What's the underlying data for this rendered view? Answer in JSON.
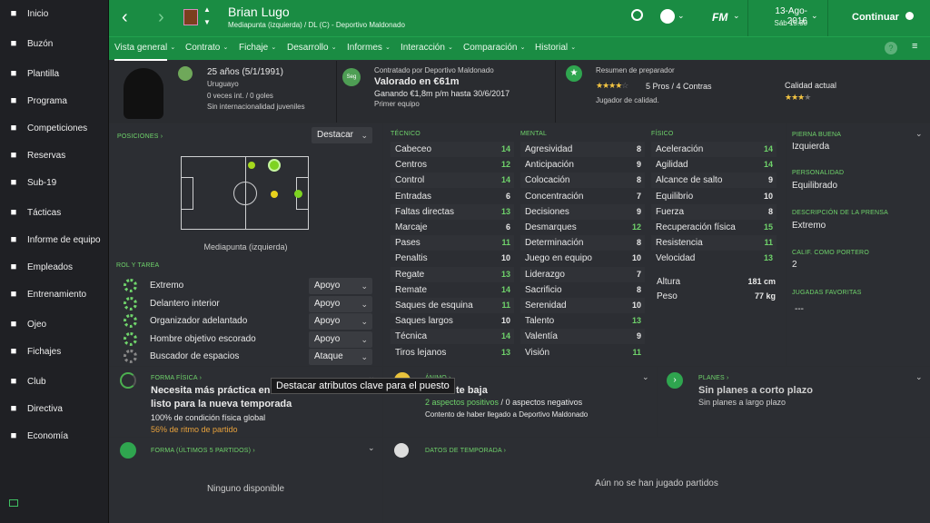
{
  "sidebar": {
    "items": [
      {
        "label": "Inicio",
        "icon": "home-icon"
      },
      {
        "label": "Buzón",
        "icon": "inbox-icon"
      },
      {
        "label": "Plantilla",
        "icon": "squad-icon"
      },
      {
        "label": "Programa",
        "icon": "schedule-icon"
      },
      {
        "label": "Competiciones",
        "icon": "trophy-icon"
      },
      {
        "label": "Reservas",
        "icon": "reserves-icon"
      },
      {
        "label": "Sub-19",
        "icon": "youth-icon"
      },
      {
        "label": "Tácticas",
        "icon": "tactics-icon"
      },
      {
        "label": "Informe de equipo",
        "icon": "report-icon"
      },
      {
        "label": "Empleados",
        "icon": "staff-icon"
      },
      {
        "label": "Entrenamiento",
        "icon": "training-icon"
      },
      {
        "label": "Ojeo",
        "icon": "scout-icon"
      },
      {
        "label": "Fichajes",
        "icon": "transfer-icon"
      },
      {
        "label": "Club",
        "icon": "club-icon"
      },
      {
        "label": "Directiva",
        "icon": "board-icon"
      },
      {
        "label": "Economía",
        "icon": "finance-icon"
      }
    ]
  },
  "top": {
    "player_name": "Brian Lugo",
    "player_sub": "Mediapunta (izquierda) / DL (C) - Deportivo Maldonado",
    "logo": "FM",
    "date": "13-Ago-2016",
    "date_sub": "Sáb 15:30",
    "continue": "Continuar"
  },
  "tabs": [
    "Vista general",
    "Contrato",
    "Fichaje",
    "Desarrollo",
    "Informes",
    "Interacción",
    "Comparación",
    "Historial"
  ],
  "header": {
    "age": "25 años (5/1/1991)",
    "nationality": "Uruguayo",
    "caps": "0 veces int. / 0 goles",
    "caps_sub": "Sin internacionalidad juveniles",
    "contract_title": "Contratado por Deportivo Maldonado",
    "value": "Valorado en €61m",
    "wage": "Ganando €1,8m p/m hasta 30/6/2017",
    "squad": "Primer equipo",
    "contract_badge": "Seg",
    "coach_title": "Resumen de preparador",
    "pros": "5 Pros / 4 Contras",
    "quality_note": "Jugador de calidad.",
    "current_ability": "Calidad actual"
  },
  "positions": {
    "label": "POSICIONES",
    "highlight": "Destacar",
    "pos_name": "Mediapunta (izquierda)"
  },
  "roles": {
    "label": "ROL Y TAREA",
    "items": [
      {
        "name": "Extremo",
        "duty": "Apoyo"
      },
      {
        "name": "Delantero interior",
        "duty": "Apoyo"
      },
      {
        "name": "Organizador adelantado",
        "duty": "Apoyo"
      },
      {
        "name": "Hombre objetivo escorado",
        "duty": "Apoyo"
      },
      {
        "name": "Buscador de espacios",
        "duty": "Ataque"
      }
    ]
  },
  "tecnico": {
    "label": "TÉCNICO",
    "items": [
      {
        "n": "Cabeceo",
        "v": "14"
      },
      {
        "n": "Centros",
        "v": "12"
      },
      {
        "n": "Control",
        "v": "14"
      },
      {
        "n": "Entradas",
        "v": "6"
      },
      {
        "n": "Faltas directas",
        "v": "13"
      },
      {
        "n": "Marcaje",
        "v": "6"
      },
      {
        "n": "Pases",
        "v": "11"
      },
      {
        "n": "Penaltis",
        "v": "10"
      },
      {
        "n": "Regate",
        "v": "13"
      },
      {
        "n": "Remate",
        "v": "14"
      },
      {
        "n": "Saques de esquina",
        "v": "11"
      },
      {
        "n": "Saques largos",
        "v": "10"
      },
      {
        "n": "Técnica",
        "v": "14"
      },
      {
        "n": "Tiros lejanos",
        "v": "13"
      }
    ]
  },
  "mental": {
    "label": "MENTAL",
    "items": [
      {
        "n": "Agresividad",
        "v": "8"
      },
      {
        "n": "Anticipación",
        "v": "9"
      },
      {
        "n": "Colocación",
        "v": "8"
      },
      {
        "n": "Concentración",
        "v": "7"
      },
      {
        "n": "Decisiones",
        "v": "9"
      },
      {
        "n": "Desmarques",
        "v": "12"
      },
      {
        "n": "Determinación",
        "v": "8"
      },
      {
        "n": "Juego en equipo",
        "v": "10"
      },
      {
        "n": "Liderazgo",
        "v": "7"
      },
      {
        "n": "Sacrificio",
        "v": "8"
      },
      {
        "n": "Serenidad",
        "v": "10"
      },
      {
        "n": "Talento",
        "v": "13"
      },
      {
        "n": "Valentía",
        "v": "9"
      },
      {
        "n": "Visión",
        "v": "11"
      }
    ]
  },
  "fisico": {
    "label": "FÍSICO",
    "items": [
      {
        "n": "Aceleración",
        "v": "14"
      },
      {
        "n": "Agilidad",
        "v": "14"
      },
      {
        "n": "Alcance de salto",
        "v": "9"
      },
      {
        "n": "Equilibrio",
        "v": "10"
      },
      {
        "n": "Fuerza",
        "v": "8"
      },
      {
        "n": "Recuperación física",
        "v": "15"
      },
      {
        "n": "Resistencia",
        "v": "11"
      },
      {
        "n": "Velocidad",
        "v": "13"
      }
    ],
    "height_label": "Altura",
    "height": "181 cm",
    "weight_label": "Peso",
    "weight": "77 kg"
  },
  "info": {
    "foot_label": "PIERNA BUENA",
    "foot": "Izquierda",
    "pers_label": "PERSONALIDAD",
    "pers": "Equilibrado",
    "press_label": "DESCRIPCIÓN DE LA PRENSA",
    "press": "Extremo",
    "gk_label": "CALIF. COMO PORTERO",
    "gk": "2",
    "fav_label": "JUGADAS FAVORITAS",
    "fav": "---"
  },
  "form": {
    "label": "FORMA FÍSICA",
    "line1": "Necesita más práctica en los",
    "line2": "listo para la nueva temporada",
    "cond": "100% de condición física global",
    "rhythm": "56% de ritmo de partido"
  },
  "morale": {
    "label": "ÁNIMO",
    "title": "te baja",
    "pos": "2 aspectos positivos",
    "neg": "0 aspectos negativos",
    "note": "Contento de haber llegado a Deportivo Maldonado"
  },
  "plans": {
    "label": "PLANES",
    "title": "Sin planes a corto plazo",
    "sub": "Sin planes a largo plazo"
  },
  "recent": {
    "label": "FORMA (ÚLTIMOS 5 PARTIDOS)",
    "empty": "Ninguno disponible"
  },
  "season": {
    "label": "DATOS DE TEMPORADA",
    "empty": "Aún no se han jugado partidos"
  },
  "tooltip": "Destacar atributos clave para el puesto",
  "colors": {
    "accent": "#1a8c43",
    "good": "#6fd36b"
  }
}
